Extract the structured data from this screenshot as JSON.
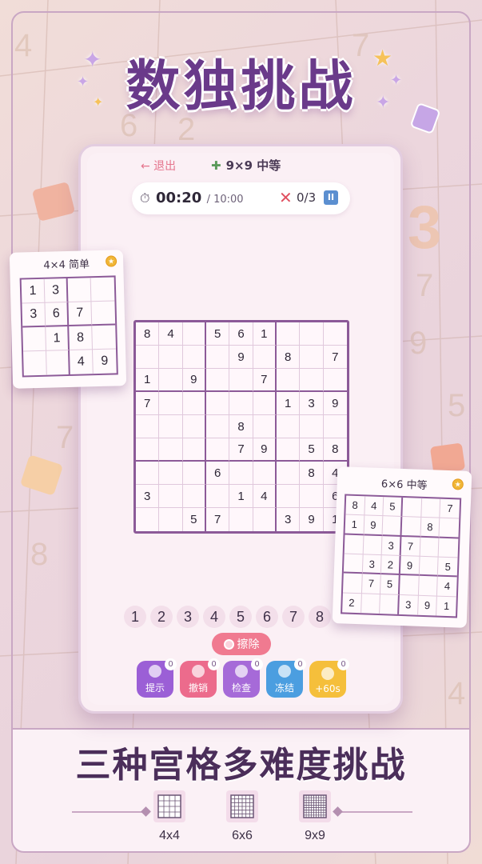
{
  "promo": {
    "title": "数独挑战",
    "subtitle": "三种宫格多难度挑战"
  },
  "game": {
    "exit_label": "← 退出",
    "mode": "9×9 中等",
    "timer": "00:20",
    "time_limit": "/ 10:00",
    "mistakes": "0/3",
    "pause_label": "II",
    "board9": [
      [
        "8",
        "4",
        "",
        "5",
        "6",
        "1",
        "",
        "",
        ""
      ],
      [
        "",
        "",
        "",
        "",
        "9",
        "",
        "8",
        "",
        "7"
      ],
      [
        "1",
        "",
        "9",
        "",
        "",
        "7",
        "",
        "",
        ""
      ],
      [
        "7",
        "",
        "",
        "",
        "",
        "",
        "1",
        "3",
        "9"
      ],
      [
        "",
        "",
        "",
        "",
        "8",
        "",
        "",
        "",
        ""
      ],
      [
        "",
        "",
        "",
        "",
        "7",
        "9",
        "",
        "5",
        "8"
      ],
      [
        "",
        "",
        "",
        "6",
        "",
        "",
        "",
        "8",
        "4"
      ],
      [
        "3",
        "",
        "",
        "",
        "1",
        "4",
        "",
        "",
        "6"
      ],
      [
        "",
        "",
        "5",
        "7",
        "",
        "",
        "3",
        "9",
        "1"
      ]
    ],
    "numpad": [
      "1",
      "2",
      "3",
      "4",
      "5",
      "6",
      "7",
      "8"
    ],
    "erase_label": "擦除",
    "tools": [
      {
        "label": "提示",
        "count": "0",
        "color": "#9b5fd6"
      },
      {
        "label": "撤销",
        "count": "0",
        "color": "#ec6b8c"
      },
      {
        "label": "检查",
        "count": "0",
        "color": "#a66ad8"
      },
      {
        "label": "冻结",
        "count": "0",
        "color": "#4b9ee0"
      },
      {
        "label": "+60s",
        "count": "0",
        "color": "#f5bf3b"
      }
    ]
  },
  "card4": {
    "title": "4×4 简单",
    "badge": "★",
    "board": [
      [
        "1",
        "3",
        "",
        ""
      ],
      [
        "3",
        "6",
        "7",
        ""
      ],
      [
        "",
        "1",
        "8",
        ""
      ],
      [
        "",
        "",
        "4",
        "9"
      ]
    ]
  },
  "card6": {
    "title": "6×6 中等",
    "badge": "★",
    "board": [
      [
        "8",
        "4",
        "5",
        "",
        "",
        "7"
      ],
      [
        "1",
        "9",
        "",
        "",
        "8",
        ""
      ],
      [
        "",
        "",
        "3",
        "7",
        "",
        ""
      ],
      [
        "",
        "3",
        "2",
        "9",
        "",
        "5"
      ],
      [
        "",
        "7",
        "5",
        "",
        "",
        "4"
      ],
      [
        "2",
        "",
        "",
        "3",
        "9",
        "1"
      ]
    ]
  },
  "sizes": [
    {
      "label": "4x4",
      "n": 4
    },
    {
      "label": "6x6",
      "n": 6
    },
    {
      "label": "9x9",
      "n": 9
    }
  ]
}
